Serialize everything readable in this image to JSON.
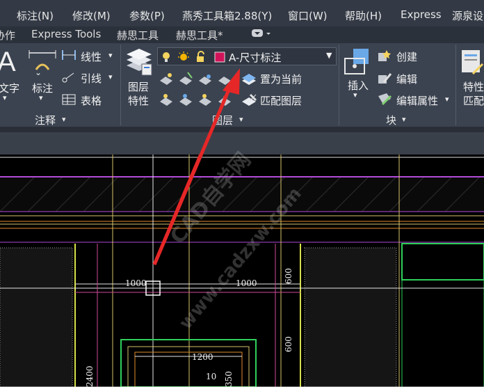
{
  "menu": {
    "items": [
      "标注(N)",
      "修改(M)",
      "参数(P)",
      "燕秀工具箱2.88(Y)",
      "窗口(W)",
      "帮助(H)",
      "Express",
      "源泉设"
    ]
  },
  "tabs": {
    "items": [
      "协作",
      "Express Tools",
      "赫思工具",
      "赫思工具*"
    ]
  },
  "ribbon": {
    "annotation": {
      "text_label": "文字",
      "dim_label": "标注",
      "linear_label": "线性",
      "leader_label": "引线",
      "table_label": "表格",
      "group_title": "注释"
    },
    "layers": {
      "props_label_line1": "图层",
      "props_label_line2": "特性",
      "current_layer": "A-尺寸标注",
      "current_layer_color": "#d1145a",
      "set_current_label": "置为当前",
      "match_label": "匹配图层",
      "group_title": "图层"
    },
    "block": {
      "insert_label": "插入",
      "create_label": "创建",
      "edit_label": "编辑",
      "edit_attr_label": "编辑属性",
      "group_title": "块"
    },
    "props": {
      "label_line1": "特性",
      "label_line2": "匹配"
    }
  },
  "drawing": {
    "dims": [
      "1000",
      "1000",
      "600",
      "600",
      "1200",
      "10",
      "2400",
      "350"
    ]
  },
  "watermark": {
    "text1": "CAD自学网",
    "text2": "www.cadzxw.com"
  }
}
